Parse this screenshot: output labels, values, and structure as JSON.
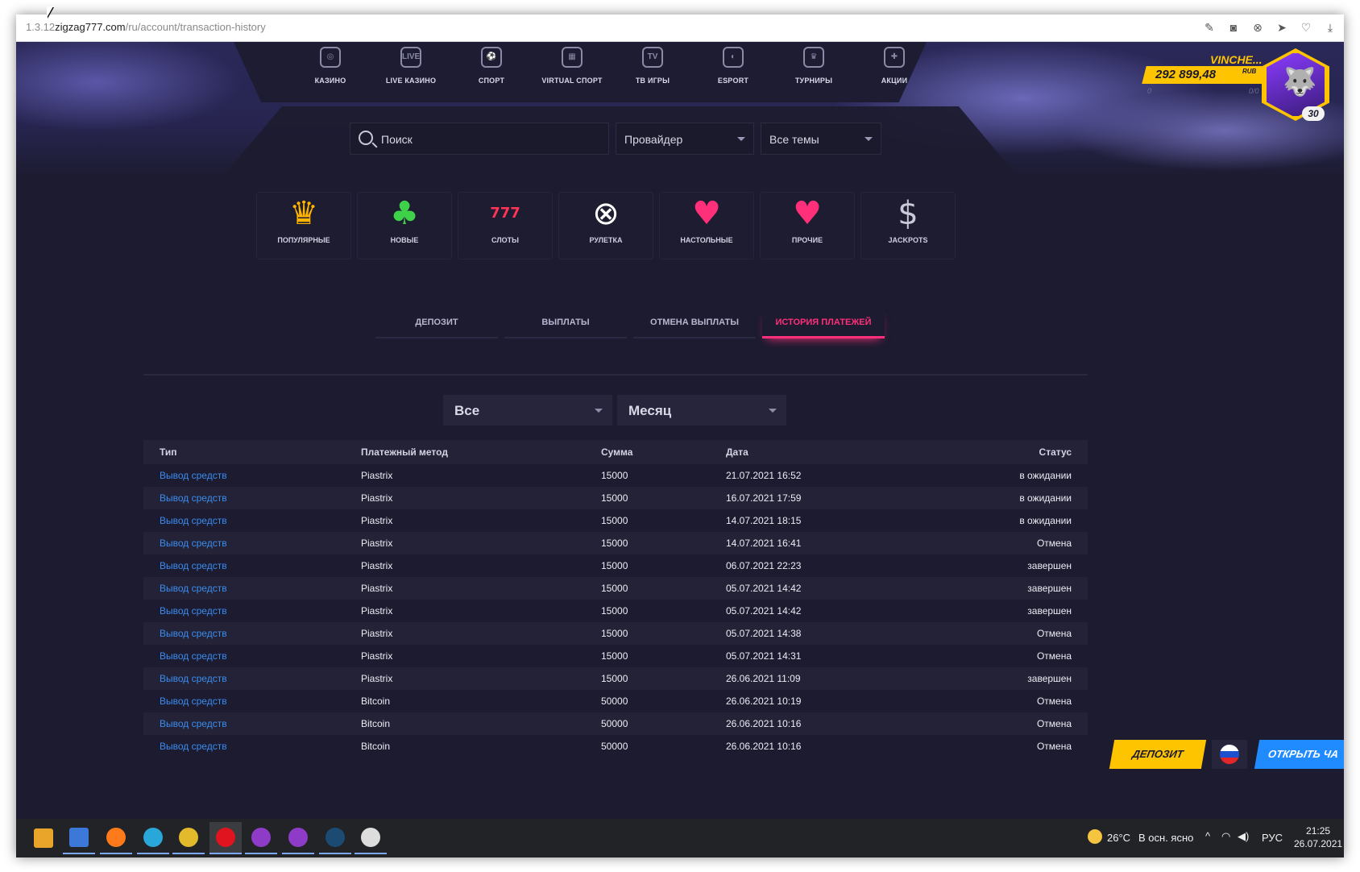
{
  "browser": {
    "url_prefix": "1.3.12",
    "url_domain": "zigzag777.com",
    "url_path": "/ru/account/transaction-history",
    "toolbar_icons": [
      "edit-icon",
      "camera-icon",
      "block-icon",
      "send-icon",
      "heart-icon",
      "download-icon"
    ]
  },
  "nav": [
    {
      "label": "КАЗИНО",
      "icon": "casino-chip-icon",
      "glyph": "◎"
    },
    {
      "label": "LIVE КАЗИНО",
      "icon": "live-icon",
      "glyph": "LIVE"
    },
    {
      "label": "СПОРТ",
      "icon": "football-icon",
      "glyph": "⚽"
    },
    {
      "label": "VIRTUAL СПОРТ",
      "icon": "virtual-field-icon",
      "glyph": "▦"
    },
    {
      "label": "ТВ ИГРЫ",
      "icon": "tv-icon",
      "glyph": "TV"
    },
    {
      "label": "ESPORT",
      "icon": "gamepad-icon",
      "glyph": "◐"
    },
    {
      "label": "ТУРНИРЫ",
      "icon": "trophy-icon",
      "glyph": "♛"
    },
    {
      "label": "АКЦИИ",
      "icon": "gift-icon",
      "glyph": "✚"
    }
  ],
  "search": {
    "placeholder": "Поиск"
  },
  "filters": {
    "provider": "Провайдер",
    "themes": "Все темы"
  },
  "categories": [
    {
      "label": "ПОПУЛЯРНЫЕ",
      "icon": "crown-icon",
      "glyph": "♛",
      "color": "#ffb400"
    },
    {
      "label": "НОВЫЕ",
      "icon": "clover-icon",
      "glyph": "♣",
      "color": "#3fd14a"
    },
    {
      "label": "СЛОТЫ",
      "icon": "slot-machine-icon",
      "glyph": "777",
      "color": "#ff3355"
    },
    {
      "label": "РУЛЕТКА",
      "icon": "roulette-icon",
      "glyph": "⊗",
      "color": "#ffffff"
    },
    {
      "label": "НАСТОЛЬНЫЕ",
      "icon": "playing-card-icon",
      "glyph": "♥",
      "color": "#ff2f7a"
    },
    {
      "label": "ПРОЧИЕ",
      "icon": "cherries-icon",
      "glyph": "♥",
      "color": "#ff2f7a"
    },
    {
      "label": "JACKPOTS",
      "icon": "money-bag-icon",
      "glyph": "$",
      "color": "#c9c9d9"
    }
  ],
  "tabs": [
    {
      "label": "ДЕПОЗИТ",
      "active": false
    },
    {
      "label": "ВЫПЛАТЫ",
      "active": false
    },
    {
      "label": "ОТМЕНА ВЫПЛАТЫ",
      "active": false
    },
    {
      "label": "ИСТОРИЯ ПЛАТЕЖЕЙ",
      "active": true
    }
  ],
  "history_filters": {
    "type": "Все",
    "period": "Месяц"
  },
  "table": {
    "headers": {
      "type": "Тип",
      "method": "Платежный метод",
      "amount": "Сумма",
      "date": "Дата",
      "status": "Статус"
    },
    "rows": [
      {
        "type": "Вывод средств",
        "method": "Piastrix",
        "amount": "15000",
        "date": "21.07.2021 16:52",
        "status": "в ожидании",
        "state": "pending"
      },
      {
        "type": "Вывод средств",
        "method": "Piastrix",
        "amount": "15000",
        "date": "16.07.2021 17:59",
        "status": "в ожидании",
        "state": "pending"
      },
      {
        "type": "Вывод средств",
        "method": "Piastrix",
        "amount": "15000",
        "date": "14.07.2021 18:15",
        "status": "в ожидании",
        "state": "pending"
      },
      {
        "type": "Вывод средств",
        "method": "Piastrix",
        "amount": "15000",
        "date": "14.07.2021 16:41",
        "status": "Отмена",
        "state": "cancel"
      },
      {
        "type": "Вывод средств",
        "method": "Piastrix",
        "amount": "15000",
        "date": "06.07.2021 22:23",
        "status": "завершен",
        "state": "done"
      },
      {
        "type": "Вывод средств",
        "method": "Piastrix",
        "amount": "15000",
        "date": "05.07.2021 14:42",
        "status": "завершен",
        "state": "done"
      },
      {
        "type": "Вывод средств",
        "method": "Piastrix",
        "amount": "15000",
        "date": "05.07.2021 14:42",
        "status": "завершен",
        "state": "done"
      },
      {
        "type": "Вывод средств",
        "method": "Piastrix",
        "amount": "15000",
        "date": "05.07.2021 14:38",
        "status": "Отмена",
        "state": "cancel"
      },
      {
        "type": "Вывод средств",
        "method": "Piastrix",
        "amount": "15000",
        "date": "05.07.2021 14:31",
        "status": "Отмена",
        "state": "cancel"
      },
      {
        "type": "Вывод средств",
        "method": "Piastrix",
        "amount": "15000",
        "date": "26.06.2021 11:09",
        "status": "завершен",
        "state": "done"
      },
      {
        "type": "Вывод средств",
        "method": "Bitcoin",
        "amount": "50000",
        "date": "26.06.2021 10:19",
        "status": "Отмена",
        "state": "cancel"
      },
      {
        "type": "Вывод средств",
        "method": "Bitcoin",
        "amount": "50000",
        "date": "26.06.2021 10:16",
        "status": "Отмена",
        "state": "cancel"
      },
      {
        "type": "Вывод средств",
        "method": "Bitcoin",
        "amount": "50000",
        "date": "26.06.2021 10:16",
        "status": "Отмена",
        "state": "cancel"
      }
    ]
  },
  "user": {
    "name": "VINCHE...",
    "balance": "292 899,48",
    "currency": "RUB",
    "progress_left": "0",
    "progress_right": "0/0",
    "level": "30"
  },
  "buttons": {
    "deposit": "ДЕПОЗИТ",
    "chat": "ОТКРЫТЬ ЧА"
  },
  "taskbar": {
    "apps": [
      {
        "icon": "start-tiles-icon",
        "color": "#e8a52a"
      },
      {
        "icon": "floppy-disk-icon",
        "color": "#3b78d8"
      },
      {
        "icon": "firefox-icon",
        "color": "#ff7a1a"
      },
      {
        "icon": "edge-icon",
        "color": "#2aa7d9"
      },
      {
        "icon": "chrome-icon",
        "color": "#e2ba2c"
      },
      {
        "icon": "opera-icon",
        "color": "#e0141e"
      },
      {
        "icon": "tor-icon",
        "color": "#8e3cc8"
      },
      {
        "icon": "tor-alt-icon",
        "color": "#8e3cc8"
      },
      {
        "icon": "steam-icon",
        "color": "#1b4a72"
      },
      {
        "icon": "ring-app-icon",
        "color": "#dddddd"
      }
    ],
    "weather": {
      "temp": "26°C",
      "desc": "В осн. ясно"
    },
    "lang": "РУС",
    "time": "21:25",
    "date": "26.07.2021"
  }
}
